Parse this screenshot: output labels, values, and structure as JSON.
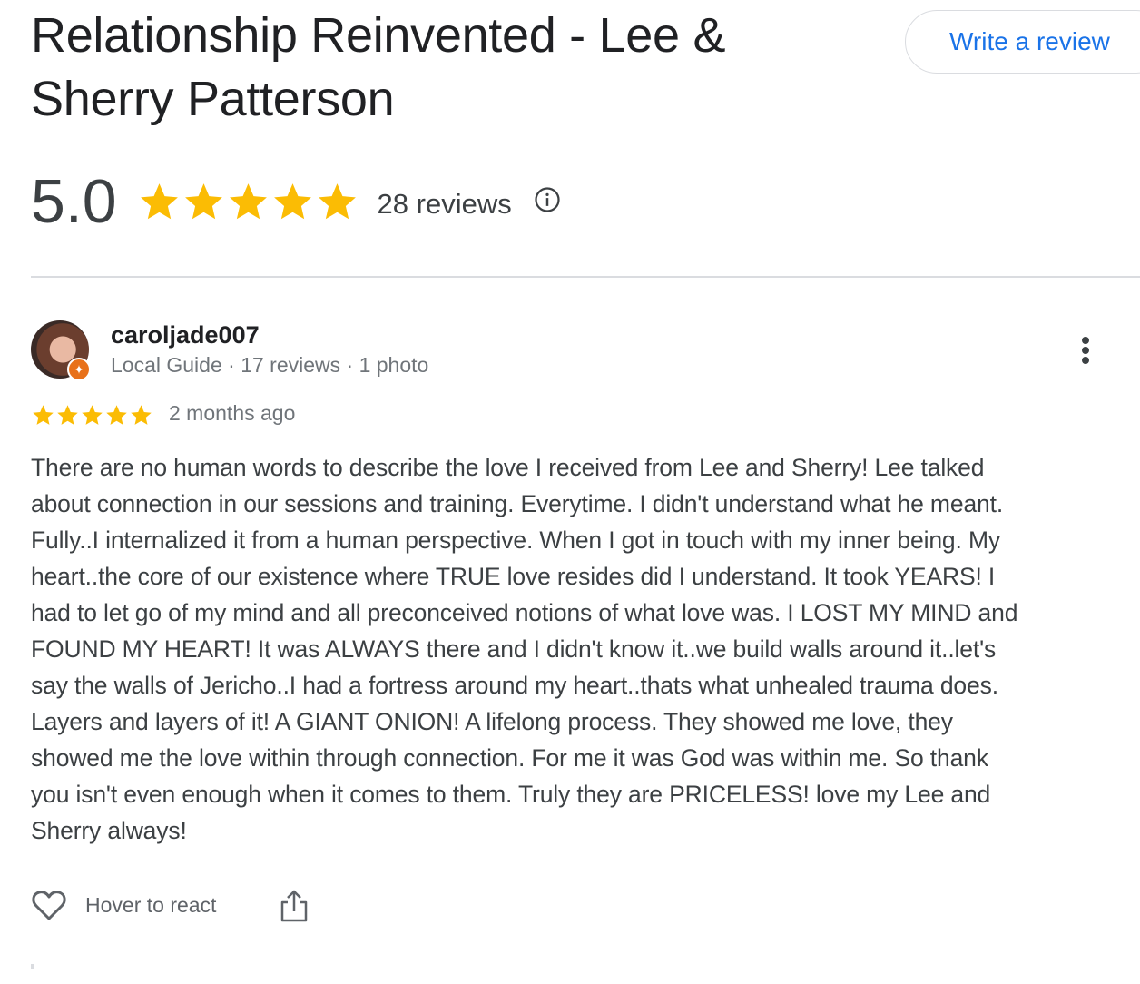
{
  "place": {
    "title": "Relationship Reinvented - Lee & Sherry Patterson",
    "write_review_label": "Write a review",
    "rating": "5.0",
    "rating_stars": 5,
    "review_count": "28 reviews"
  },
  "colors": {
    "star": "#fbbc04",
    "link": "#1a73e8",
    "text": "#3c4043",
    "muted": "#70757a",
    "badge": "#e8711a"
  },
  "icons": {
    "info": "info-icon",
    "more": "more-vert-icon",
    "heart": "heart-icon",
    "share": "share-icon",
    "star": "star-icon"
  },
  "review": {
    "author": "caroljade007",
    "author_meta": "Local Guide · 17 reviews · 1 photo",
    "stars": 5,
    "time_ago": "2 months ago",
    "text": "There are no human words to describe the love I received from Lee and Sherry! Lee talked\nabout connection in our sessions and training. Everytime. I didn't understand what he meant.\nFully..I internalized it from a human perspective. When I got in touch with my inner being. My\nheart..the core of our existence where TRUE love resides did I understand. It took YEARS! I\nhad to let go of my mind and all preconceived notions of what love was. I LOST MY MIND and\nFOUND MY HEART! It was ALWAYS there and I didn't know it..we build walls around it..let's\nsay the walls of Jericho..I had a fortress around my heart..thats what unhealed trauma does.\nLayers and layers of it! A GIANT ONION! A lifelong process. They showed me love, they\nshowed me the love within through connection. For me it was God was within me. So thank\nyou isn't even enough when it comes to them. Truly they are PRICELESS! love my Lee and\nSherry always!",
    "react_label": "Hover to react"
  }
}
